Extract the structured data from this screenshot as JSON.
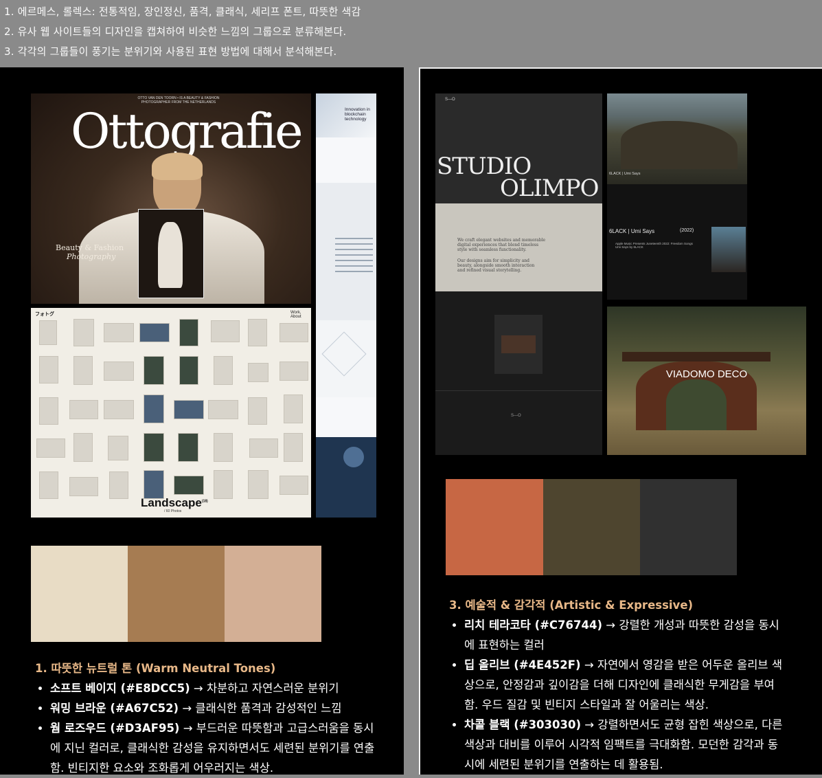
{
  "header": {
    "lines": [
      "1. 에르메스, 롤렉스: 전통적임, 장인정신, 품격, 클래식, 세리프 폰트, 따뜻한 색감",
      "2. 유사 웹 사이트들의 디자인을 캡쳐하여 비슷한 느낌의 그룹으로 분류해본다.",
      "3. 각각의 그룹들이 풍기는 분위기와 사용된 표현 방법에 대해서 분석해본다."
    ]
  },
  "left": {
    "ottografie": {
      "title": "Ottografie",
      "top_caption": "OTTO VAN DEN TOORN • IS A BEAUTY & FASHION PHOTOGRAPHER FROM THE NETHERLANDS",
      "sub1": "Beauty & Fashion",
      "sub2": "Photography"
    },
    "blockchain": {
      "headline": "Innovation in blockchain technology"
    },
    "landscape": {
      "logo": "フォトグ",
      "nav": "Work, About",
      "title": "Landscape",
      "title_sup": "(18)",
      "subtitle": "/ 60 Photos"
    },
    "palette": {
      "colors": [
        "#E8DCC5",
        "#A67C52",
        "#D3AF95"
      ]
    },
    "notes": {
      "heading": "1. 따뜻한 뉴트럴 톤 (Warm Neutral Tones)",
      "items": [
        {
          "name": "소프트 베이지 (#E8DCC5)",
          "desc": " → 차분하고 자연스러운 분위기"
        },
        {
          "name": "워밍 브라운 (#A67C52)",
          "desc": " → 클래식한 품격과 감성적인 느낌"
        },
        {
          "name": "웜 로즈우드 (#D3AF95)",
          "desc": " → 부드러운 따뜻함과 고급스러움을 동시에 지닌 컬러로, 클래식한 감성을 유지하면서도 세련된 분위기를 연출함. 빈티지한 요소와 조화롭게 어우러지는 색상."
        }
      ]
    }
  },
  "right": {
    "studio": {
      "logo": "S—O",
      "line1": "STUDIO",
      "line2": "OLIMPO",
      "body1": "We craft elegant websites and memorable digital experiences that blend timeless style with seamless functionality.",
      "body2": "Our designs aim for simplicity and beauty, alongside smooth interaction and refined visual storytelling."
    },
    "blackk": {
      "caption": "6LACK | Umi Says",
      "title": "6LACK | Umi Says",
      "year": "(2022)",
      "desc": "Apple Music Presents Juneteenth 2022: Freedom Songs Umi Says by 6LACK"
    },
    "viadomo": {
      "title": "VIADOMO DECO"
    },
    "palette": {
      "colors": [
        "#C76744",
        "#4E452F",
        "#303030"
      ]
    },
    "notes": {
      "heading": "3. 예술적 & 감각적 (Artistic & Expressive)",
      "items": [
        {
          "name": "리치 테라코타 (#C76744)",
          "desc": " → 강렬한 개성과 따뜻한 감성을 동시에 표현하는 컬러"
        },
        {
          "name": "딥 올리브 (#4E452F)",
          "desc": " → 자연에서 영감을 받은 어두운 올리브 색상으로, 안정감과 깊이감을 더해 디자인에 클래식한 무게감을 부여함. 우드 질감 및 빈티지 스타일과 잘 어울리는 색상."
        },
        {
          "name": "차콜 블랙 (#303030)",
          "desc": " → 강렬하면서도 균형 잡힌 색상으로, 다른 색상과 대비를 이루어 시각적 임팩트를 극대화함. 모던한 감각과 동시에 세련된 분위기를 연출하는 데 활용됨."
        }
      ]
    }
  }
}
